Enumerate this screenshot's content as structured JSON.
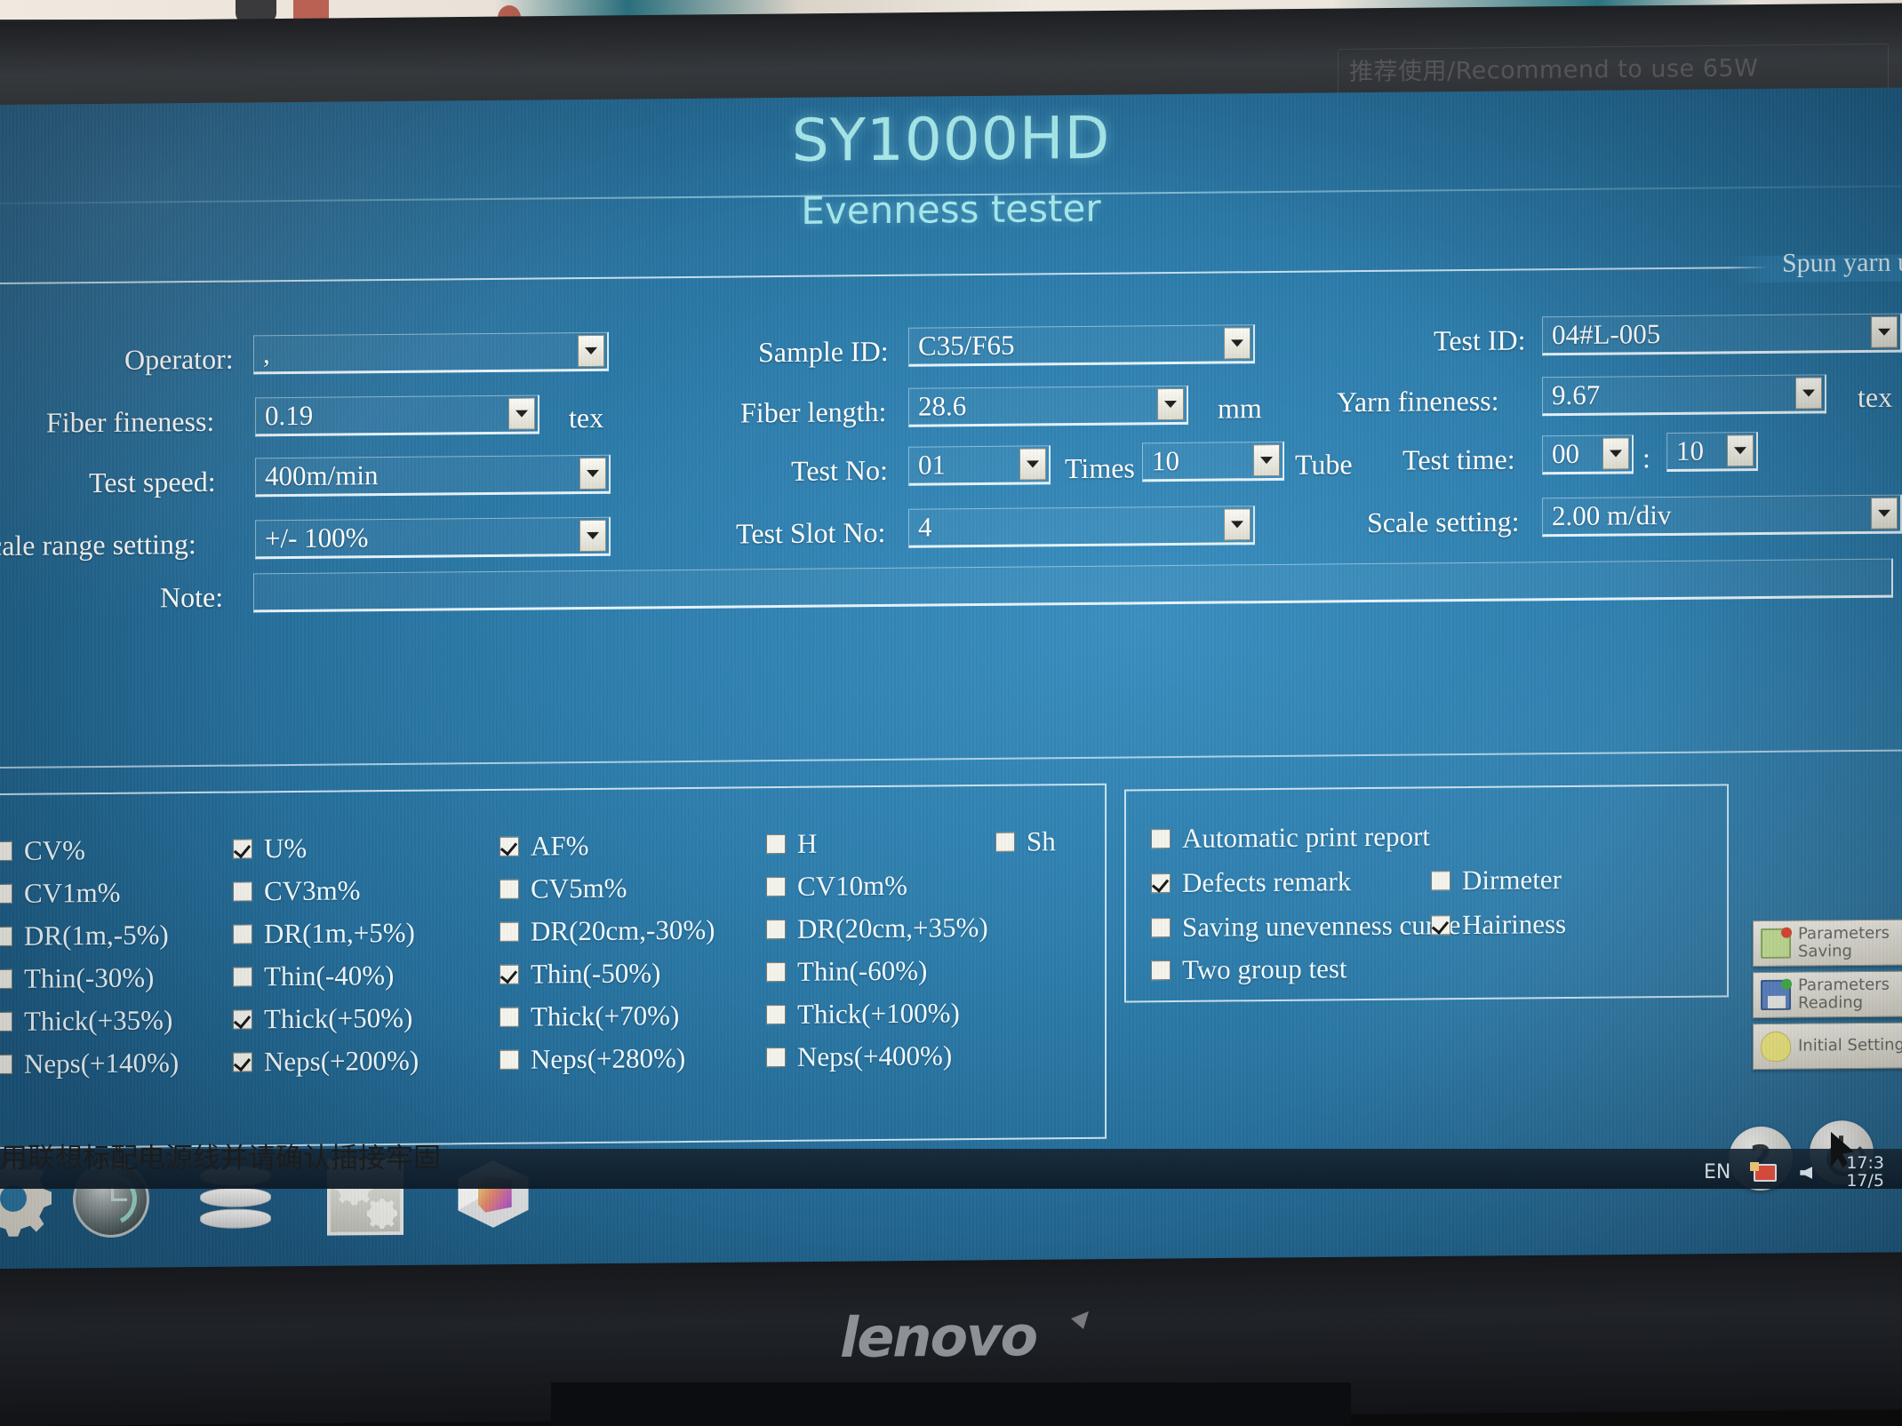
{
  "bezel": {
    "sticker_text": "推荐使用/Recommend to use 65W",
    "brand": "lenovo"
  },
  "header": {
    "title": "SY1000HD",
    "subtitle": "Evenness tester"
  },
  "params_group": {
    "legend": "Spun yarn u"
  },
  "form": {
    "operator": {
      "label": "Operator:",
      "value": ","
    },
    "fiber_fineness": {
      "label": "Fiber fineness:",
      "value": "0.19",
      "unit": "tex"
    },
    "test_speed": {
      "label": "Test speed:",
      "value": "400m/min"
    },
    "scale_range_setting": {
      "label": "cale range setting:",
      "value": "+/-  100%"
    },
    "note": {
      "label": "Note:",
      "value": ""
    },
    "sample_id": {
      "label": "Sample ID:",
      "value": "C35/F65"
    },
    "fiber_length": {
      "label": "Fiber length:",
      "value": "28.6",
      "unit": "mm"
    },
    "test_no": {
      "label": "Test No:",
      "value": "01",
      "times_label": "Times",
      "times_value": "10",
      "tube_label": "Tube"
    },
    "test_slot_no": {
      "label": "Test Slot No:",
      "value": "4"
    },
    "test_id": {
      "label": "Test ID:",
      "value": "04#L-005"
    },
    "yarn_fineness": {
      "label": "Yarn fineness:",
      "value": "9.67",
      "unit": "tex"
    },
    "test_time": {
      "label": "Test time:",
      "hours": "00",
      "separator": ":",
      "minutes": "10"
    },
    "scale_setting": {
      "label": "Scale setting:",
      "value": "2.00   m/div"
    }
  },
  "measurements": [
    {
      "label": "CV%",
      "checked": false,
      "col": 0,
      "row": 0
    },
    {
      "label": "U%",
      "checked": true,
      "col": 1,
      "row": 0
    },
    {
      "label": "AF%",
      "checked": true,
      "col": 2,
      "row": 0
    },
    {
      "label": "H",
      "checked": false,
      "col": 3,
      "row": 0
    },
    {
      "label": "Sh",
      "checked": false,
      "col": 4,
      "row": 0
    },
    {
      "label": "CV1m%",
      "checked": false,
      "col": 0,
      "row": 1
    },
    {
      "label": "CV3m%",
      "checked": false,
      "col": 1,
      "row": 1
    },
    {
      "label": "CV5m%",
      "checked": false,
      "col": 2,
      "row": 1
    },
    {
      "label": "CV10m%",
      "checked": false,
      "col": 3,
      "row": 1
    },
    {
      "label": "DR(1m,-5%)",
      "checked": false,
      "col": 0,
      "row": 2
    },
    {
      "label": "DR(1m,+5%)",
      "checked": false,
      "col": 1,
      "row": 2
    },
    {
      "label": "DR(20cm,-30%)",
      "checked": false,
      "col": 2,
      "row": 2
    },
    {
      "label": "DR(20cm,+35%)",
      "checked": false,
      "col": 3,
      "row": 2
    },
    {
      "label": "Thin(-30%)",
      "checked": false,
      "col": 0,
      "row": 3
    },
    {
      "label": "Thin(-40%)",
      "checked": false,
      "col": 1,
      "row": 3
    },
    {
      "label": "Thin(-50%)",
      "checked": true,
      "col": 2,
      "row": 3
    },
    {
      "label": "Thin(-60%)",
      "checked": false,
      "col": 3,
      "row": 3
    },
    {
      "label": "Thick(+35%)",
      "checked": false,
      "col": 0,
      "row": 4
    },
    {
      "label": "Thick(+50%)",
      "checked": true,
      "col": 1,
      "row": 4
    },
    {
      "label": "Thick(+70%)",
      "checked": false,
      "col": 2,
      "row": 4
    },
    {
      "label": "Thick(+100%)",
      "checked": false,
      "col": 3,
      "row": 4
    },
    {
      "label": "Neps(+140%)",
      "checked": false,
      "col": 0,
      "row": 5
    },
    {
      "label": "Neps(+200%)",
      "checked": true,
      "col": 1,
      "row": 5
    },
    {
      "label": "Neps(+280%)",
      "checked": false,
      "col": 2,
      "row": 5
    },
    {
      "label": "Neps(+400%)",
      "checked": false,
      "col": 3,
      "row": 5
    }
  ],
  "options": [
    {
      "label": "Automatic print report",
      "checked": false,
      "col": 0,
      "row": 0
    },
    {
      "label": "Defects remark",
      "checked": true,
      "col": 0,
      "row": 1
    },
    {
      "label": "Saving unevenness curve",
      "checked": false,
      "col": 0,
      "row": 2
    },
    {
      "label": "Two group test",
      "checked": false,
      "col": 0,
      "row": 3
    },
    {
      "label": "Dirmeter",
      "checked": false,
      "col": 1,
      "row": 1
    },
    {
      "label": "Hairiness",
      "checked": true,
      "col": 1,
      "row": 2
    }
  ],
  "side_buttons": [
    {
      "label": "Parameters\nSaving",
      "icon": "save-icon"
    },
    {
      "label": "Parameters\nReading",
      "icon": "floppy-icon"
    },
    {
      "label": "Initial Setting",
      "icon": "bulb-icon"
    }
  ],
  "dock": [
    {
      "icon": "gear-icon"
    },
    {
      "icon": "history-clock-icon"
    },
    {
      "icon": "database-icon"
    },
    {
      "icon": "settings-gears-icon"
    },
    {
      "icon": "chart-cube-icon"
    }
  ],
  "corner_buttons": [
    {
      "icon": "help-icon",
      "glyph": "?"
    },
    {
      "icon": "power-icon",
      "glyph": ""
    }
  ],
  "taskbar": {
    "notice": "用联想标配电源线并请确认插接牢固",
    "language": "EN",
    "network_icon": "network-icon",
    "volume_icon": "volume-mute-icon",
    "date_line1": "17:3",
    "date_line2": "17/5"
  },
  "colors": {
    "screen_blue": "#2e7ead",
    "title_cyan": "#a9ecee",
    "text_white": "#f2fbff",
    "field_border": "#e6f4fc"
  }
}
